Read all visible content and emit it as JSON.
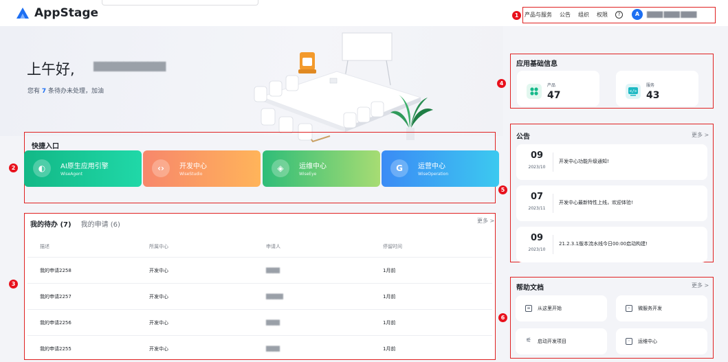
{
  "header": {
    "app_name": "AppStage",
    "nav": [
      "产品与服务",
      "公告",
      "组织",
      "权限"
    ],
    "help_icon": "?",
    "avatar_letter": "A",
    "username": "████ ████ ████"
  },
  "badges": [
    "1",
    "2",
    "3",
    "4",
    "5",
    "6"
  ],
  "hero": {
    "greeting": "上午好,",
    "name": "████████████",
    "pending_prefix": "您有",
    "pending_count": "7",
    "pending_suffix": "条待办未处理，加油"
  },
  "quick": {
    "title": "快捷入口",
    "tiles": [
      {
        "name": "AI原生应用引擎",
        "sub": "WiseAgent",
        "icon": "◐",
        "color_from": "#12b886",
        "color_to": "#20d8a8"
      },
      {
        "name": "开发中心",
        "sub": "WiseStudio",
        "icon": "‹›",
        "color_from": "#f7876b",
        "color_to": "#ffb45a"
      },
      {
        "name": "运维中心",
        "sub": "WiseEye",
        "icon": "◈",
        "color_from": "#2fbd78",
        "color_to": "#a7dc73"
      },
      {
        "name": "运营中心",
        "sub": "WiseOperation",
        "icon": "G",
        "color_from": "#3b8bf5",
        "color_to": "#3cc9f0"
      }
    ]
  },
  "todo": {
    "tabs": [
      "我的待办 (7)",
      "我的申请 (6)"
    ],
    "more": "更多 >",
    "columns": [
      "描述",
      "所属中心",
      "申请人",
      "停留时间"
    ],
    "rows": [
      {
        "desc": "我的申请2258",
        "center": "开发中心",
        "applicant": "████",
        "time": "1月前"
      },
      {
        "desc": "我的申请2257",
        "center": "开发中心",
        "applicant": "█████",
        "time": "1月前"
      },
      {
        "desc": "我的申请2256",
        "center": "开发中心",
        "applicant": "████",
        "time": "1月前"
      },
      {
        "desc": "我的申请2255",
        "center": "开发中心",
        "applicant": "████",
        "time": "1月前"
      }
    ]
  },
  "app_info": {
    "title": "应用基础信息",
    "stats": [
      {
        "label": "产品",
        "value": "47",
        "icon": "grid-icon",
        "color": "#16b98a"
      },
      {
        "label": "服务",
        "value": "43",
        "icon": "code-icon",
        "color": "#1db9c3"
      }
    ]
  },
  "notices": {
    "title": "公告",
    "more": "更多 >",
    "items": [
      {
        "day": "09",
        "ym": "2023/10",
        "text": "开发中心功能升级通知!"
      },
      {
        "day": "07",
        "ym": "2023/11",
        "text": "开发中心最新特性上线，欢迎体验!"
      },
      {
        "day": "09",
        "ym": "2023/10",
        "text": "21.2.3.1版本流水线今日00:00启动构建!"
      }
    ]
  },
  "help": {
    "title": "帮助文档",
    "more": "更多 >",
    "items": [
      {
        "label": "从这里开始",
        "icon": "doc-icon"
      },
      {
        "label": "微服务开发",
        "icon": "terminal-icon"
      },
      {
        "label": "启动开发项目",
        "icon": "sliders-icon"
      },
      {
        "label": "运维中心",
        "icon": "doc-search-icon"
      }
    ]
  }
}
